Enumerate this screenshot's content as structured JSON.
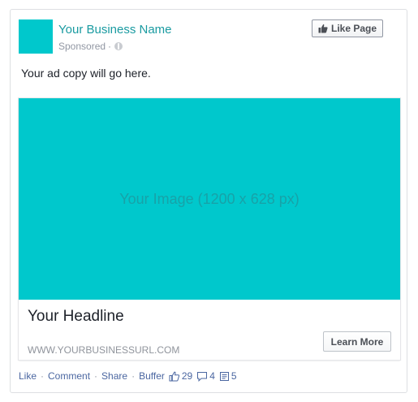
{
  "post": {
    "business_name": "Your Business Name",
    "sponsored_label": "Sponsored",
    "meta_separator": "·",
    "like_page_label": "Like Page",
    "ad_copy": "Your ad copy will go here.",
    "brand_color": "#00c8cc"
  },
  "ad": {
    "image_label": "Your Image (1200 x 628 px)",
    "headline": "Your Headline",
    "url": "WWW.YOURBUSINESSURL.COM",
    "cta_label": "Learn More"
  },
  "actions": {
    "like": "Like",
    "comment": "Comment",
    "share": "Share",
    "buffer": "Buffer",
    "separator": "·",
    "like_count": "29",
    "comment_count": "4",
    "share_count": "5"
  },
  "icons": {
    "globe": "globe-icon",
    "thumb": "thumbs-up-icon",
    "comment": "comment-icon",
    "share": "share-icon"
  }
}
